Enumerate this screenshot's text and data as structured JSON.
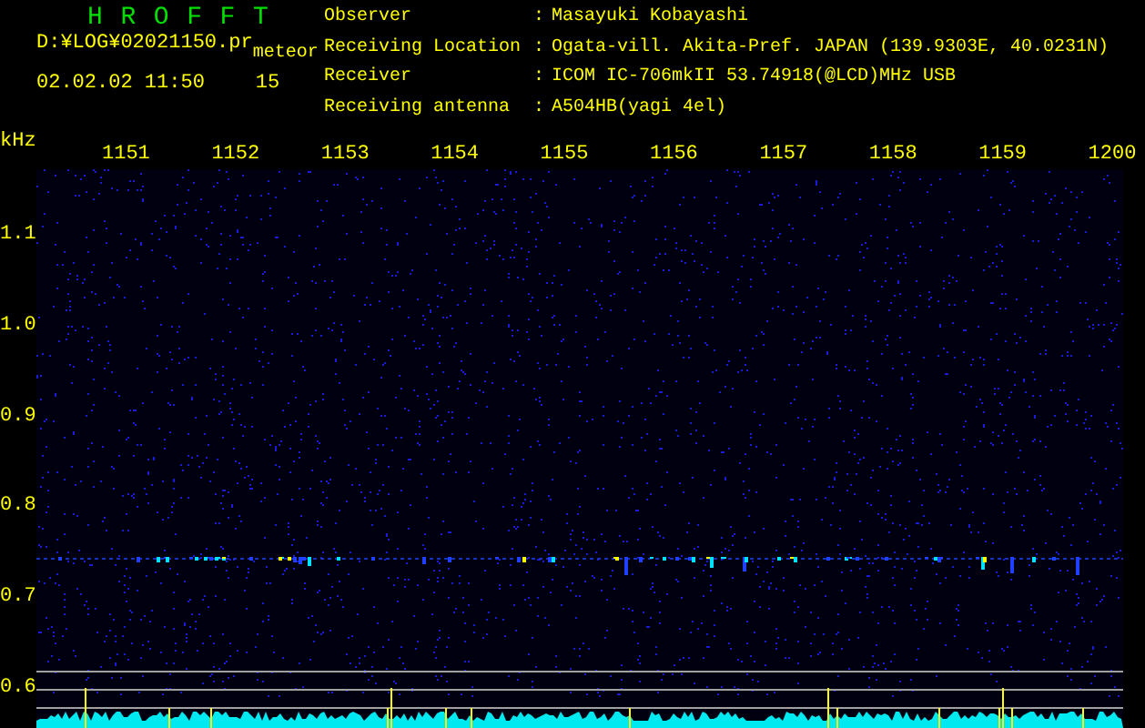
{
  "header": {
    "title": "HROFFT",
    "file": "D:¥LOG¥02021150.pr",
    "mode": "meteor",
    "datetime": "02.02.02 11:50",
    "count": "15"
  },
  "station": [
    {
      "label": "Observer",
      "separator": ":",
      "value": "Masayuki Kobayashi"
    },
    {
      "label": "Receiving Location",
      "separator": ":",
      "value": "Ogata-vill. Akita-Pref. JAPAN (139.9303E, 40.0231N)"
    },
    {
      "label": "Receiver",
      "separator": ":",
      "value": "ICOM IC-706mkII 53.74918(@LCD)MHz USB"
    },
    {
      "label": "Receiving antenna",
      "separator": ":",
      "value": "A504HB(yagi 4el)"
    }
  ],
  "plot": {
    "unit": "kHz",
    "time_labels": [
      "1151",
      "1152",
      "1153",
      "1154",
      "1155",
      "1156",
      "1157",
      "1158",
      "1159",
      "1200"
    ],
    "freq_labels": [
      "1.1",
      "1.0",
      "0.9",
      "0.8",
      "0.7",
      "0.6"
    ]
  }
}
